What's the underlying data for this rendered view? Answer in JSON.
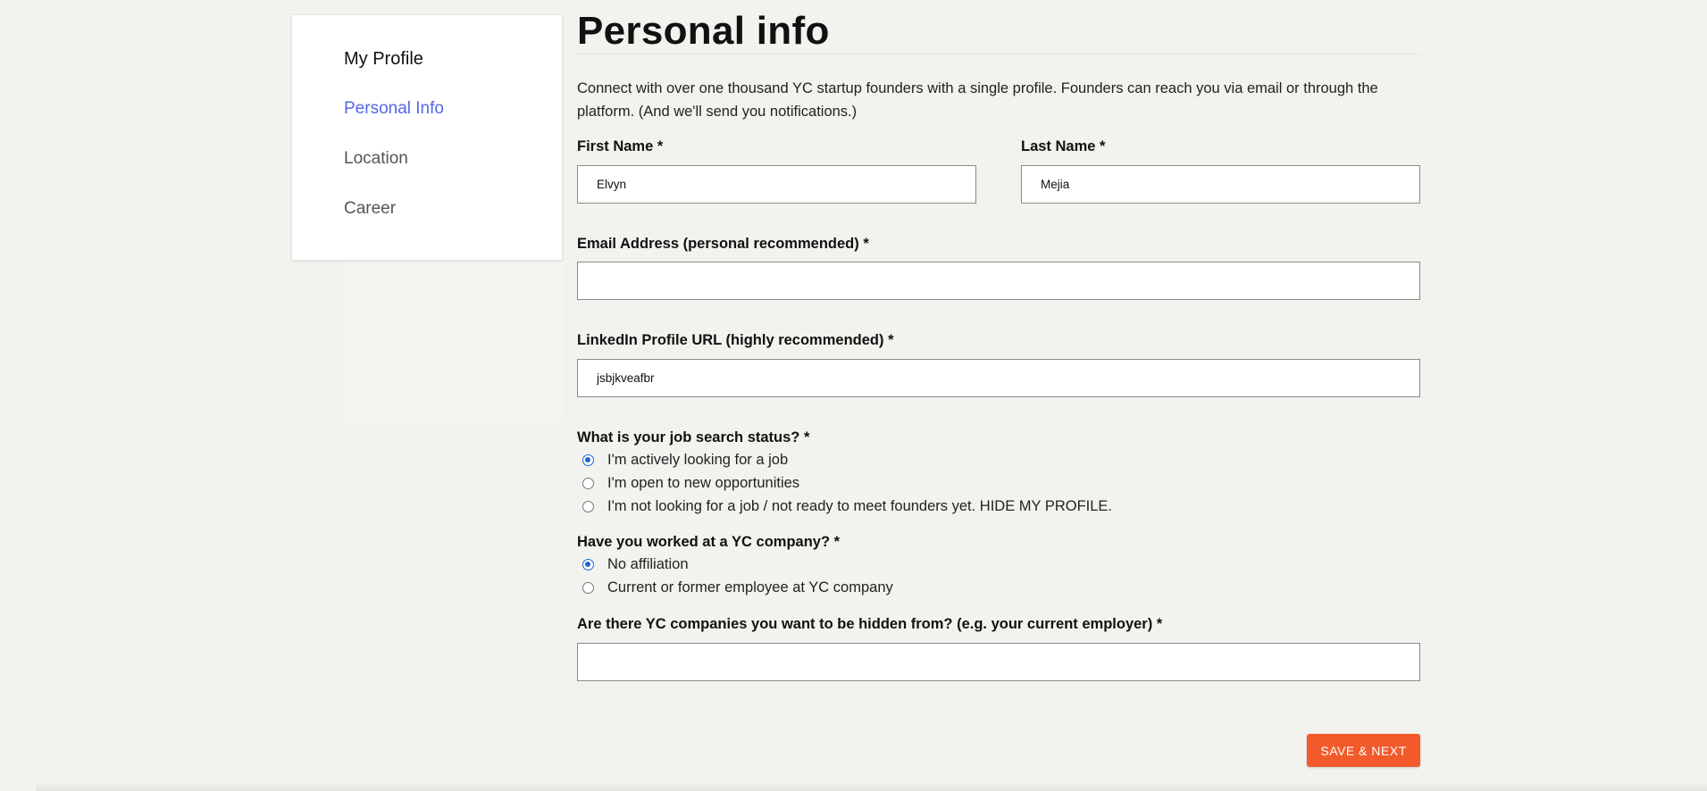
{
  "sidebar": {
    "title": "My Profile",
    "items": [
      {
        "label": "Personal Info",
        "active": true
      },
      {
        "label": "Location",
        "active": false
      },
      {
        "label": "Career",
        "active": false
      }
    ]
  },
  "main": {
    "title": "Personal info",
    "intro": "Connect with over one thousand YC startup founders with a single profile. Founders can reach you via email or through the platform. (And we'll send you notifications.)"
  },
  "form": {
    "first_name": {
      "label": "First Name *",
      "value": "Elvyn"
    },
    "last_name": {
      "label": "Last Name *",
      "value": "Mejia"
    },
    "email": {
      "label": "Email Address (personal recommended) *",
      "value": ""
    },
    "linkedin": {
      "label": "LinkedIn Profile URL (highly recommended) *",
      "value": "jsbjkveafbr"
    },
    "job_search": {
      "label": "What is your job search status? *",
      "options": [
        {
          "label": "I'm actively looking for a job",
          "checked": true
        },
        {
          "label": "I'm open to new opportunities",
          "checked": false
        },
        {
          "label": "I'm not looking for a job / not ready to meet founders yet. HIDE MY PROFILE.",
          "checked": false
        }
      ]
    },
    "yc_worked": {
      "label": "Have you worked at a YC company? *",
      "options": [
        {
          "label": "No affiliation",
          "checked": true
        },
        {
          "label": "Current or former employee at YC company",
          "checked": false
        }
      ]
    },
    "hidden_from": {
      "label": "Are there YC companies you want to be hidden from? (e.g. your current employer) *",
      "value": ""
    }
  },
  "actions": {
    "save_label": "SAVE & NEXT"
  },
  "colors": {
    "accent": "#5566e6",
    "button": "#f35a2b",
    "radio": "#2065d8",
    "background": "#f2f2ee"
  }
}
